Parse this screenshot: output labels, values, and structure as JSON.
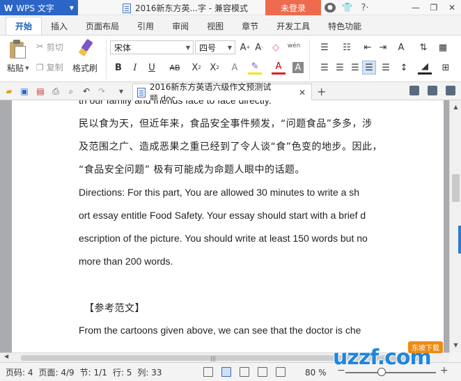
{
  "titlebar": {
    "app_name": "WPS 文字",
    "doc_title": "2016新东方英...字 - 兼容模式",
    "login_label": "未登录"
  },
  "menu_tabs": [
    "开始",
    "插入",
    "页面布局",
    "引用",
    "审阅",
    "视图",
    "章节",
    "开发工具",
    "特色功能"
  ],
  "ribbon": {
    "paste_label": "粘贴",
    "cut_label": "剪切",
    "copy_label": "复制",
    "format_painter_label": "格式刷",
    "font_name": "宋体",
    "font_size": "四号",
    "pinyin_icon_label": "wén"
  },
  "doc_tab": {
    "filename": "2016新东方英语六级作文预测试题.doc"
  },
  "document": {
    "lines": [
      "th our family and friends  face to face directly.",
      "民以食为天，但近年来，食品安全事件频发，“问题食品”多多，涉",
      "及范围之广、造成恶果之重已经到了令人谈“食”色变的地步。因此，",
      "“食品安全问题” 极有可能成为命题人眼中的话题。",
      "  Directions: For this part, You are allowed 30 minutes to write a sh",
      "ort essay entitle Food Safety. Your essay should start with a brief d",
      "escription of the picture. You should write at least 150 words but no",
      " more than 200 words.",
      "【参考范文】",
      " From the cartoons given above, we can see that the doctor is che"
    ]
  },
  "statusbar": {
    "page_code": "页码: 4",
    "page": "页面: 4/9",
    "section": "节: 1/1",
    "row": "行: 5",
    "col": "列: 33",
    "zoom": "80 %"
  },
  "watermark": {
    "brand": "uzzf.com",
    "badge": "东坡下载"
  },
  "colors": {
    "wps_blue": "#2b66c7",
    "login_orange": "#ee6b4f",
    "tab_active_text": "#1d5fb8"
  }
}
